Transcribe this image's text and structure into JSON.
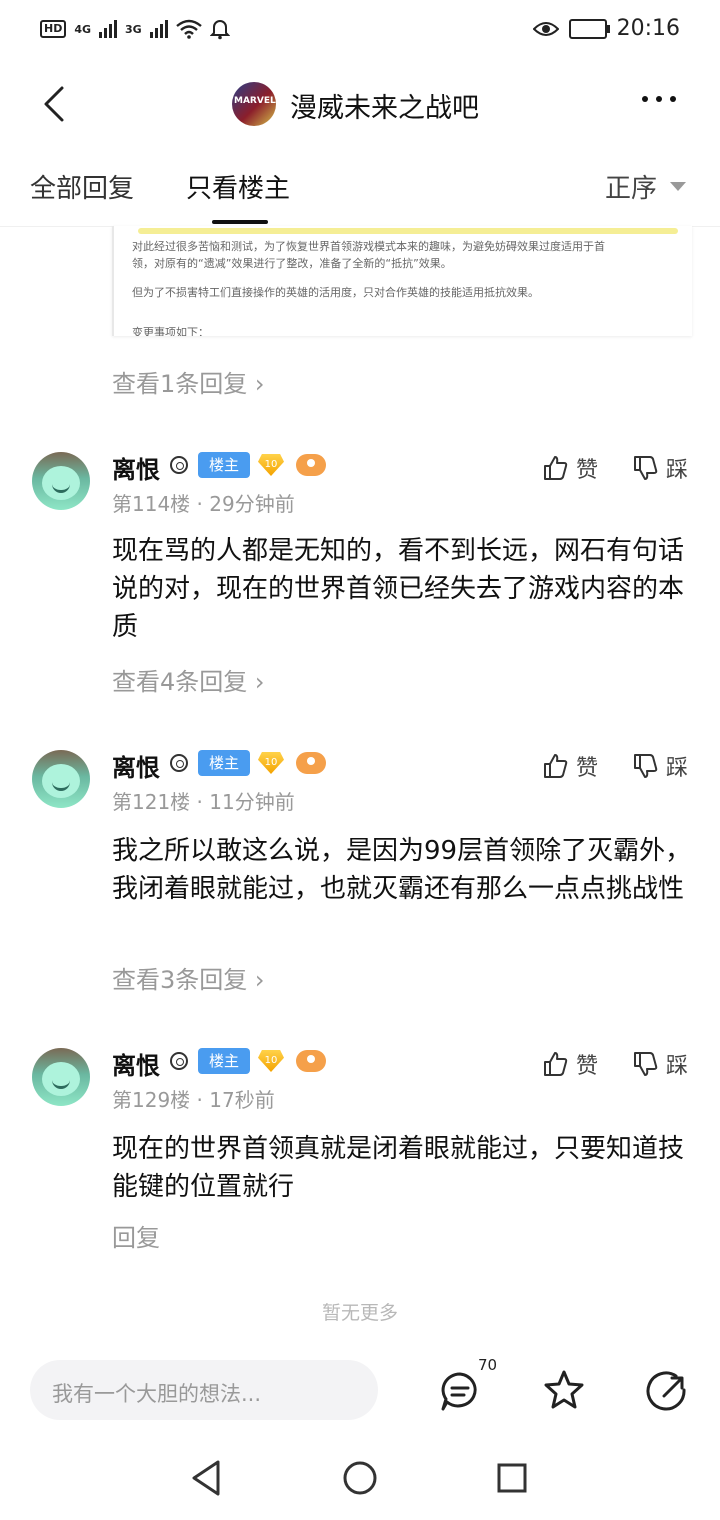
{
  "status_bar": {
    "left_indicators": [
      "HD",
      "4G",
      "3G"
    ],
    "time": "20:16"
  },
  "header": {
    "forum_logo_text": "MARVEL",
    "title": "漫威未来之战吧"
  },
  "tabs": {
    "all_replies": "全部回复",
    "owner_only": "只看楼主",
    "order": "正序"
  },
  "quoted_image": {
    "lines": [
      "对此经过很多苦恼和测试，为了恢复世界首领游戏模式本来的趣味，为避免妨碍效果过度适用于首",
      "领，对原有的“遗减”效果进行了整改，准备了全新的“抵抗”效果。",
      "但为了不损害特工们直接操作的英雄的活用度，只对合作英雄的技能适用抵抗效果。",
      "变更事项如下："
    ]
  },
  "first_view_replies": "查看1条回复",
  "posts": [
    {
      "username": "离恨",
      "owner_badge": "楼主",
      "level": "10",
      "floor": "第114楼",
      "time": "29分钟前",
      "content": "现在骂的人都是无知的，看不到长远，网石有句话说的对，现在的世界首领已经失去了游戏内容的本质",
      "like_label": "赞",
      "dislike_label": "踩",
      "replies_label": "查看4条回复"
    },
    {
      "username": "离恨",
      "owner_badge": "楼主",
      "level": "10",
      "floor": "第121楼",
      "time": "11分钟前",
      "content": "我之所以敢这么说，是因为99层首领除了灭霸外，我闭着眼就能过，也就灭霸还有那么一点点挑战性",
      "like_label": "赞",
      "dislike_label": "踩",
      "replies_label": "查看3条回复"
    },
    {
      "username": "离恨",
      "owner_badge": "楼主",
      "level": "10",
      "floor": "第129楼",
      "time": "17秒前",
      "content": "现在的世界首领真就是闭着眼就能过，只要知道技能键的位置就行",
      "like_label": "赞",
      "dislike_label": "踩",
      "replies_label": "回复"
    }
  ],
  "no_more": "暂无更多",
  "bottom_bar": {
    "comment_placeholder": "我有一个大胆的想法...",
    "comment_count": "70"
  },
  "icons": {
    "back": "back-arrow-icon",
    "more": "more-dots-icon",
    "like": "thumbs-up-icon",
    "dislike": "thumbs-down-icon",
    "comment": "comment-icon",
    "star": "star-icon",
    "share": "share-icon"
  },
  "colors": {
    "owner_badge": "#4a9cf0",
    "level_badge": "#f4a300",
    "muted_text": "#999999"
  }
}
